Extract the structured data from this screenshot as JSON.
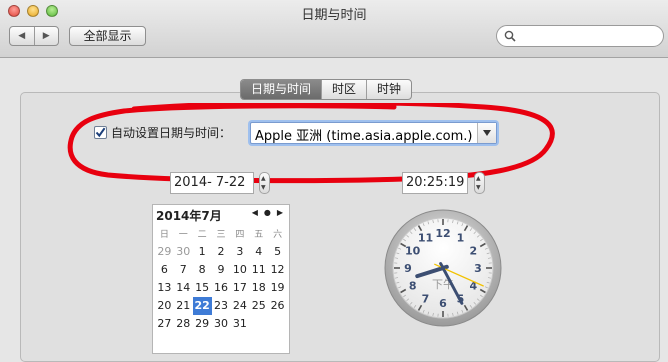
{
  "window": {
    "title": "日期与时间"
  },
  "toolbar": {
    "back_glyph": "◀",
    "forward_glyph": "▶",
    "show_all_label": "全部显示",
    "search_placeholder": ""
  },
  "tabs": [
    {
      "label": "日期与时间",
      "active": true
    },
    {
      "label": "时区"
    },
    {
      "label": "时钟"
    }
  ],
  "auto": {
    "checked": true,
    "label": "自动设置日期与时间：",
    "server": "Apple 亚洲 (time.asia.apple.com.)"
  },
  "date_field": {
    "value": "2014- 7-22"
  },
  "time_field": {
    "value": "20:25:19"
  },
  "calendar": {
    "month_label": "2014年7月",
    "weekdays": [
      "日",
      "一",
      "二",
      "三",
      "四",
      "五",
      "六"
    ],
    "rows": [
      [
        "29",
        "30",
        "1",
        "2",
        "3",
        "4",
        "5"
      ],
      [
        "6",
        "7",
        "8",
        "9",
        "10",
        "11",
        "12"
      ],
      [
        "13",
        "14",
        "15",
        "16",
        "17",
        "18",
        "19"
      ],
      [
        "20",
        "21",
        "22",
        "23",
        "24",
        "25",
        "26"
      ],
      [
        "27",
        "28",
        "29",
        "30",
        "31",
        "",
        ""
      ]
    ],
    "selected_day": "22"
  },
  "clock": {
    "numerals": [
      "12",
      "1",
      "2",
      "3",
      "4",
      "5",
      "6",
      "7",
      "8",
      "9",
      "10",
      "11"
    ],
    "pm_label": "下午",
    "hour": 8,
    "minute": 25,
    "second": 19
  },
  "colors": {
    "annotation": "#e8000f",
    "selection": "#3e7bd6",
    "second_hand": "#f2c200",
    "hands": "#3c4e72"
  }
}
